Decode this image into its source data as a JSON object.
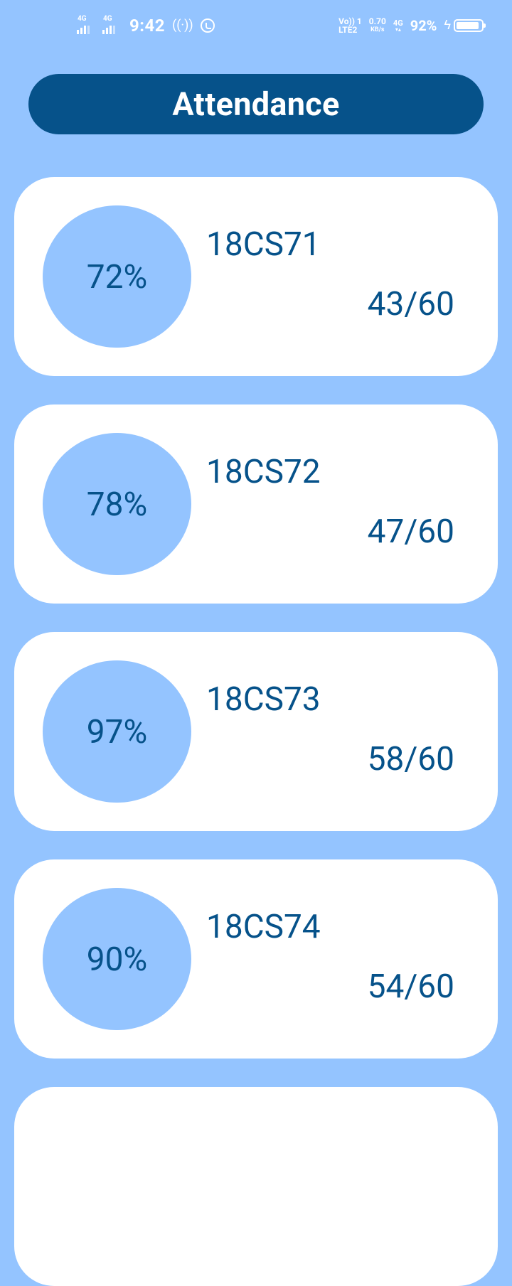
{
  "status_bar": {
    "sim1_network": "4G",
    "sim2_network": "4G",
    "time": "9:42",
    "volte_line1": "Vo)) 1",
    "volte_line2": "LTE2",
    "speed_value": "0.70",
    "speed_unit": "KB/s",
    "data_network": "4G",
    "battery_percent": "92%",
    "battery_level": 0.92,
    "charging": true
  },
  "header": {
    "title": "Attendance"
  },
  "subjects": [
    {
      "percent": "72%",
      "code": "18CS71",
      "attended": "43/60"
    },
    {
      "percent": "78%",
      "code": "18CS72",
      "attended": "47/60"
    },
    {
      "percent": "97%",
      "code": "18CS73",
      "attended": "58/60"
    },
    {
      "percent": "90%",
      "code": "18CS74",
      "attended": "54/60"
    }
  ],
  "colors": {
    "background": "#94c4ff",
    "primary": "#06528a",
    "card": "#ffffff"
  }
}
